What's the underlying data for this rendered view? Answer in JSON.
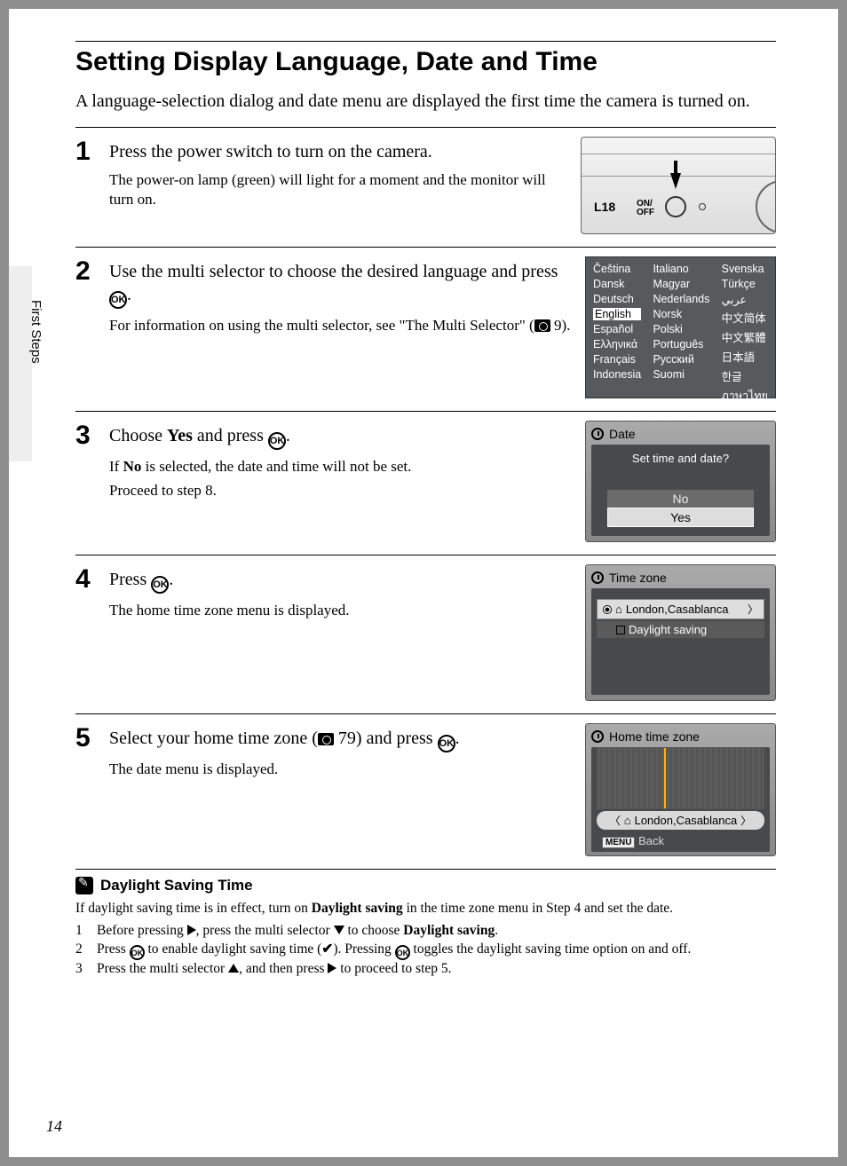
{
  "side_tab": "First Steps",
  "title": "Setting Display Language, Date and Time",
  "intro": "A language-selection dialog and date menu are displayed the first time the camera is turned on.",
  "page_number": "14",
  "steps": {
    "s1": {
      "num": "1",
      "title": "Press the power switch to turn on the camera.",
      "sub": "The power-on lamp (green) will light for a moment and the monitor will turn on.",
      "fig": {
        "model": "L18",
        "onoff": "ON/\nOFF"
      }
    },
    "s2": {
      "num": "2",
      "title_a": "Use the multi selector to choose the desired language and press ",
      "title_b": ".",
      "sub_a": "For information on using the multi selector, see \"The Multi Selector\" (",
      "sub_ref": " 9).",
      "languages": {
        "col1": [
          "Čeština",
          "Dansk",
          "Deutsch",
          "English",
          "Español",
          "Ελληνικά",
          "Français",
          "Indonesia"
        ],
        "col2": [
          "Italiano",
          "Magyar",
          "Nederlands",
          "Norsk",
          "Polski",
          "Português",
          "Русский",
          "Suomi"
        ],
        "col3": [
          "Svenska",
          "Türkçe",
          "عربي",
          "中文简体",
          "中文繁體",
          "日本語",
          "한글",
          "ภาษาไทย"
        ]
      }
    },
    "s3": {
      "num": "3",
      "title_a": "Choose ",
      "title_yes": "Yes",
      "title_b": " and press ",
      "title_c": ".",
      "sub_a": "If ",
      "sub_no": "No",
      "sub_b": " is selected, the date and time will not be set.",
      "sub2": "Proceed to step 8.",
      "lcd": {
        "hdr": "Date",
        "q": "Set time and date?",
        "no": "No",
        "yes": "Yes"
      }
    },
    "s4": {
      "num": "4",
      "title_a": "Press ",
      "title_b": ".",
      "sub": "The home time zone menu is displayed.",
      "lcd": {
        "hdr": "Time zone",
        "row1": "London,Casablanca",
        "row2": "Daylight saving"
      }
    },
    "s5": {
      "num": "5",
      "title_a": "Select your home time zone (",
      "title_ref": " 79) and press ",
      "title_b": ".",
      "sub": "The date menu is displayed.",
      "lcd": {
        "hdr": "Home time zone",
        "label": "London,Casablanca",
        "menu": "MENU",
        "back": "Back"
      }
    }
  },
  "note": {
    "title": "Daylight Saving Time",
    "p": "If daylight saving time is in effect, turn on ",
    "p_b": "Daylight saving",
    "p2": " in the time zone menu in Step 4 and set the date.",
    "l1a": "Before pressing ",
    "l1b": ", press the multi selector ",
    "l1c": " to choose ",
    "l1d": "Daylight saving",
    "l1e": ".",
    "l2a": "Press ",
    "l2b": " to enable daylight saving time (",
    "l2c": "). Pressing ",
    "l2d": " toggles the daylight saving time option on and off.",
    "l3a": "Press the multi selector ",
    "l3b": ", and then press ",
    "l3c": " to proceed to step 5."
  },
  "ok_label": "OK"
}
